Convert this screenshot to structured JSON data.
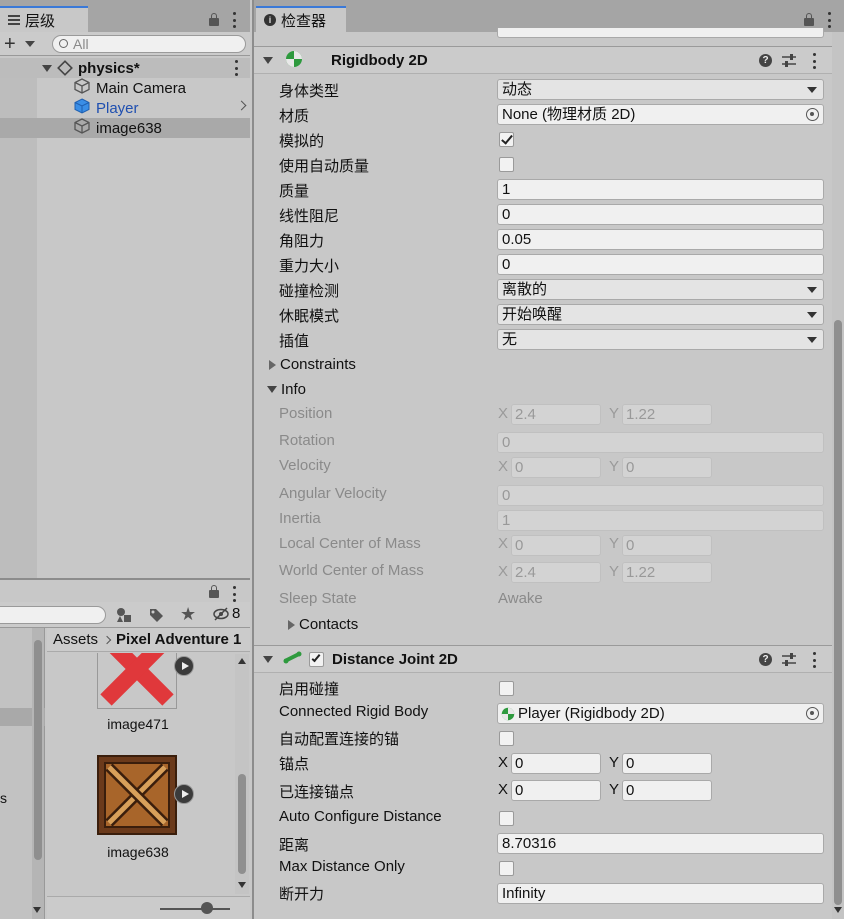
{
  "hierarchy": {
    "tab_label": "层级",
    "search_placeholder": "All",
    "scene_name": "physics*",
    "items": [
      {
        "label": "Main Camera",
        "color": "#111111"
      },
      {
        "label": "Player",
        "color": "#1f4fb0"
      },
      {
        "label": "image638",
        "color": "#111111"
      }
    ]
  },
  "project": {
    "hidden_count": "8",
    "breadcrumb": [
      "Assets",
      "Pixel Adventure 1"
    ],
    "assets": [
      {
        "label": "image471",
        "icon": "red-x-icon"
      },
      {
        "label": "image638",
        "icon": "wooden-box-icon"
      }
    ],
    "left_clipped_text": "s"
  },
  "inspector": {
    "tab_label": "检查器",
    "rigidbody": {
      "title": "Rigidbody 2D",
      "fields": {
        "body_type_label": "身体类型",
        "body_type_value": "动态",
        "material_label": "材质",
        "material_value": "None (物理材质 2D)",
        "simulated_label": "模拟的",
        "auto_mass_label": "使用自动质量",
        "mass_label": "质量",
        "mass_value": "1",
        "linear_drag_label": "线性阻尼",
        "linear_drag_value": "0",
        "angular_drag_label": "角阻力",
        "angular_drag_value": "0.05",
        "gravity_label": "重力大小",
        "gravity_value": "0",
        "collision_label": "碰撞检测",
        "collision_value": "离散的",
        "sleep_label": "休眠模式",
        "sleep_value": "开始唤醒",
        "interp_label": "插值",
        "interp_value": "无"
      },
      "constraints_label": "Constraints",
      "info": {
        "label": "Info",
        "position_label": "Position",
        "position_x": "2.4",
        "position_y": "1.22",
        "rotation_label": "Rotation",
        "rotation_value": "0",
        "velocity_label": "Velocity",
        "velocity_x": "0",
        "velocity_y": "0",
        "ang_vel_label": "Angular Velocity",
        "ang_vel_value": "0",
        "inertia_label": "Inertia",
        "inertia_value": "1",
        "local_com_label": "Local Center of Mass",
        "local_com_x": "0",
        "local_com_y": "0",
        "world_com_label": "World Center of Mass",
        "world_com_x": "2.4",
        "world_com_y": "1.22",
        "sleep_state_label": "Sleep State",
        "sleep_state_value": "Awake",
        "contacts_label": "Contacts"
      }
    },
    "distance_joint": {
      "title": "Distance Joint 2D",
      "enable_collision_label": "启用碰撞",
      "connected_rb_label": "Connected Rigid Body",
      "connected_rb_value": "Player (Rigidbody 2D)",
      "auto_anchor_label": "自动配置连接的锚",
      "anchor_label": "锚点",
      "anchor_x": "0",
      "anchor_y": "0",
      "connected_anchor_label": "已连接锚点",
      "connected_anchor_x": "0",
      "connected_anchor_y": "0",
      "auto_distance_label": "Auto Configure Distance",
      "distance_label": "距离",
      "distance_value": "8.70316",
      "max_distance_label": "Max Distance Only",
      "break_force_label": "断开力",
      "break_force_value": "Infinity"
    },
    "x_label": "X",
    "y_label": "Y"
  }
}
